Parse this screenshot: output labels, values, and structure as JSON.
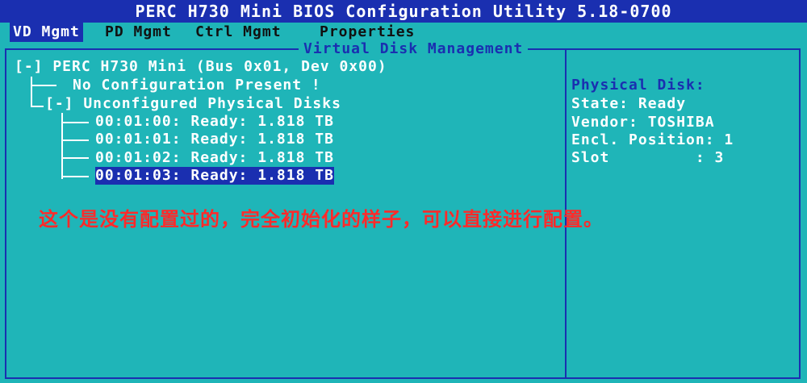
{
  "title": "PERC H730 Mini BIOS Configuration Utility 5.18-0700",
  "tabs": [
    {
      "label": "VD Mgmt",
      "active": true
    },
    {
      "label": "PD Mgmt",
      "active": false
    },
    {
      "label": "Ctrl Mgmt",
      "active": false
    },
    {
      "label": "Properties",
      "active": false
    }
  ],
  "panel": {
    "title": "Virtual Disk Management"
  },
  "tree": {
    "controller": "[-] PERC H730 Mini (Bus 0x01, Dev 0x00)",
    "no_config": "No Configuration Present !",
    "unconfigured": "[-] Unconfigured Physical Disks",
    "disks": [
      "00:01:00: Ready: 1.818 TB",
      "00:01:01: Ready: 1.818 TB",
      "00:01:02: Ready: 1.818 TB",
      "00:01:03: Ready: 1.818 TB"
    ],
    "selected_index": 3
  },
  "properties": {
    "heading": "Physical Disk:",
    "state": "State: Ready",
    "vendor": "Vendor: TOSHIBA",
    "encl": "Encl. Position: 1",
    "slot": "Slot         : 3"
  },
  "annotation": "这个是没有配置过的，完全初始化的样子，可以直接进行配置。",
  "colors": {
    "background": "#1fb5b8",
    "highlight": "#1a2fb0",
    "annotation": "#ff2a2a"
  }
}
